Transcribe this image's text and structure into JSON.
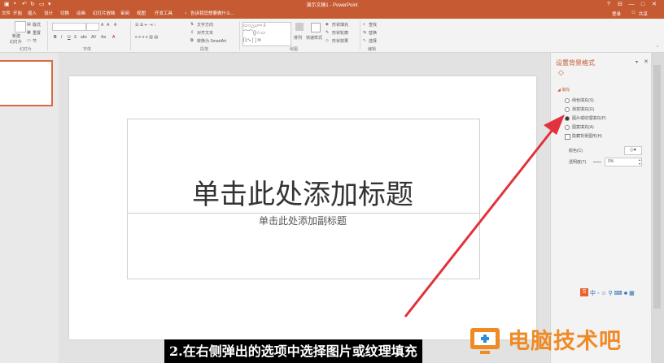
{
  "window": {
    "title": "演示文稿1 - PowerPoint",
    "controls": [
      "?",
      "⊟",
      "—",
      "□",
      "✕"
    ]
  },
  "tabs": [
    "文件",
    "开始",
    "插入",
    "设计",
    "切换",
    "动画",
    "幻灯片放映",
    "审阅",
    "视图",
    "开发工具"
  ],
  "tell_me": "告诉我您想要做什么...",
  "account": {
    "login": "登录",
    "share": "共享"
  },
  "ribbon": {
    "groups": {
      "slides": "幻灯片",
      "font": "字体",
      "paragraph": "段落",
      "drawing": "绘图",
      "editing": "编辑"
    },
    "new_slide": "新建",
    "new_slide_sub": "幻灯片",
    "layout": "版式",
    "reset": "重置",
    "section": "节",
    "text_direction": "文字方向",
    "align_text": "对齐文本",
    "convert_smartart": "转换为 SmartArt",
    "arrange": "排列",
    "quick_styles": "快速样式",
    "shape_fill": "形状填充",
    "shape_outline": "形状轮廓",
    "shape_effects": "形状效果",
    "find": "查找",
    "replace": "替换",
    "select": "选择"
  },
  "slide": {
    "title_placeholder": "单击此处添加标题",
    "subtitle_placeholder": "单击此处添加副标题"
  },
  "format_pane": {
    "title": "设置背景格式",
    "section_fill": "填充",
    "options": [
      "纯色填充(S)",
      "渐变填充(G)",
      "图片或纹理填充(P)",
      "图案填充(A)"
    ],
    "selected_index": 2,
    "hide_bg": "隐藏背景图形(H)",
    "color_label": "颜色(C)",
    "transparency_label": "透明度(T)",
    "transparency_value": "0%"
  },
  "caption": "2.在右侧弹出的选项中选择图片或纹理填充",
  "watermark": "电脑技术吧",
  "colors": {
    "accent": "#c55a33",
    "arrow": "#e0333d",
    "watermark": "#f08a24"
  }
}
